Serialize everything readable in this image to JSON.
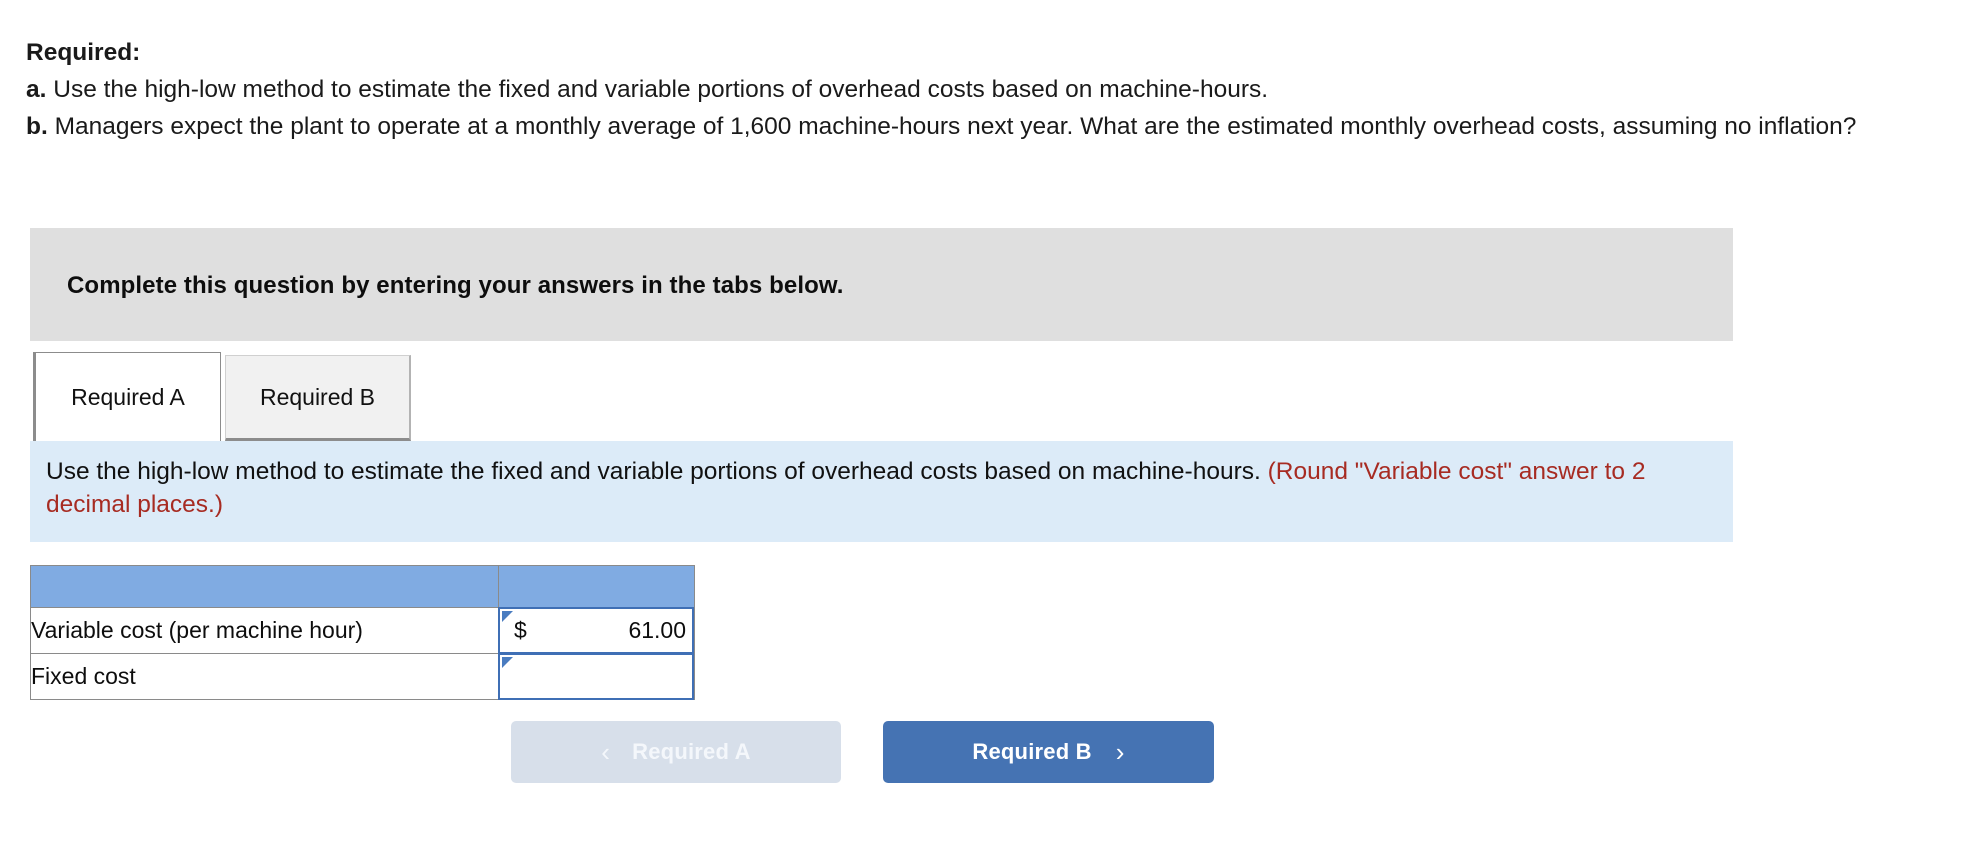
{
  "prompt": {
    "heading": "Required:",
    "item_a_marker": "a.",
    "item_a": " Use the high-low method to estimate the fixed and variable portions of overhead costs based on machine-hours.",
    "item_b_marker": "b.",
    "item_b": " Managers expect the plant to operate at a monthly average of 1,600 machine-hours next year. What are the estimated monthly overhead costs, assuming no inflation?"
  },
  "banner": {
    "text": "Complete this question by entering your answers in the tabs below."
  },
  "tabs": [
    {
      "label": "Required A",
      "active": true
    },
    {
      "label": "Required B",
      "active": false
    }
  ],
  "instruction": {
    "main": "Use the high-low method to estimate the fixed and variable portions of overhead costs based on machine-hours. ",
    "note": "(Round \"Variable cost\" answer to 2 decimal places.)"
  },
  "table": {
    "header": {
      "label_col": "",
      "value_col": ""
    },
    "rows": [
      {
        "label": "Variable cost (per machine hour)",
        "currency": "$",
        "value": "61.00"
      },
      {
        "label": "Fixed cost",
        "currency": "",
        "value": ""
      }
    ]
  },
  "nav": {
    "prev_label": "Required A",
    "prev_icon": "chevron-left-icon",
    "prev_chevron": "‹",
    "prev_disabled": true,
    "next_label": "Required B",
    "next_icon": "chevron-right-icon",
    "next_chevron": "›"
  },
  "colors": {
    "banner_bg": "#dfdfdf",
    "panel_bg": "#dcebf8",
    "note_red": "#a72b22",
    "table_header_blue": "#80abe2",
    "input_border_blue": "#3f6fb5",
    "btn_primary": "#4573b3",
    "btn_disabled": "#d7dfea"
  }
}
